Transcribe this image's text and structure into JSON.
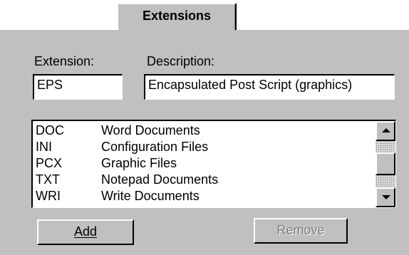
{
  "tab": {
    "label": "Extensions"
  },
  "extension": {
    "label": "Extension:",
    "value": "EPS"
  },
  "description": {
    "label": "Description:",
    "value": "Encapsulated Post Script (graphics)"
  },
  "list": {
    "items": [
      {
        "ext": "DOC",
        "desc": "Word Documents"
      },
      {
        "ext": "INI",
        "desc": "Configuration Files"
      },
      {
        "ext": "PCX",
        "desc": "Graphic Files"
      },
      {
        "ext": "TXT",
        "desc": "Notepad Documents"
      },
      {
        "ext": "WRI",
        "desc": "Write Documents"
      }
    ]
  },
  "buttons": {
    "add_label": "Add",
    "remove_label": "Remove"
  },
  "icons": {
    "scroll_up": "arrow-up-icon",
    "scroll_down": "arrow-down-icon"
  }
}
